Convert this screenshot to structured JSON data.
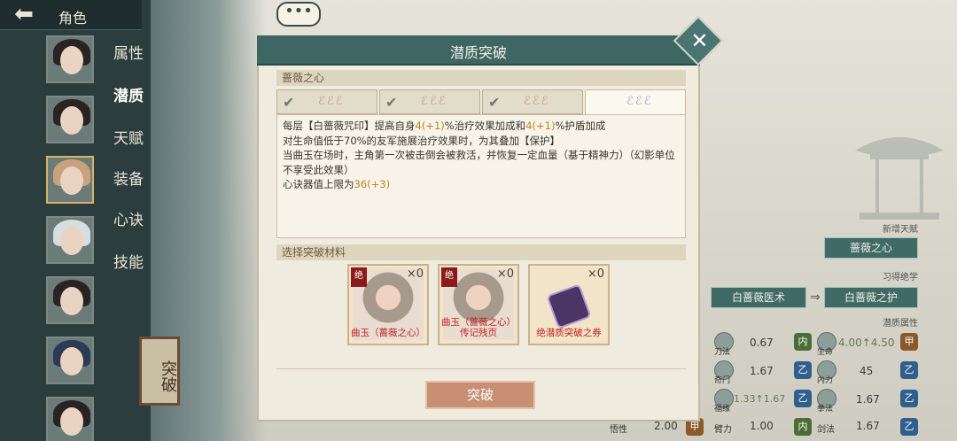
{
  "top_bar": {
    "title": "角色",
    "back_icon": "back-arrow-icon"
  },
  "sidebar": {
    "menu": [
      "属性",
      "潜质",
      "天赋",
      "装备",
      "心诀",
      "技能"
    ],
    "current": "潜质",
    "break_sign": "突破"
  },
  "bubble": {
    "text": "•••"
  },
  "modal": {
    "title": "潜质突破",
    "section_talent": "蔷薇之心",
    "tabs": [
      {
        "check": "✔",
        "sig": "ℰℰℰ",
        "active": false
      },
      {
        "check": "✔",
        "sig": "ℰℰℰ",
        "active": false
      },
      {
        "check": "✔",
        "sig": "ℰℰℰ",
        "active": false
      },
      {
        "check": "",
        "sig": "ℰℰℰ",
        "active": true
      }
    ],
    "desc": {
      "l1a": "每层【白蔷薇咒印】提高自身",
      "l1n1": "4(+1)",
      "l1b": "%治疗效果加成和",
      "l1n2": "4(+1)",
      "l1c": "%护盾加成",
      "l2": "对生命值低于70%的友军施展治疗效果时，为其叠加【保护】",
      "l3": "当曲玉在场时，主角第一次被击倒会被救活，并恢复一定血量（基于精神力）（幻影单位不享受此效果）",
      "l4a": "心诀器值上限为",
      "l4n": "36(+3)"
    },
    "section_material": "选择突破材料",
    "materials": [
      {
        "badge": "绝",
        "count": "×0",
        "name": "曲玉（蔷薇之心）"
      },
      {
        "badge": "绝",
        "count": "×0",
        "name": "曲玉（蔷薇之心）传记残页"
      },
      {
        "badge": "",
        "count": "×0",
        "name": "绝潜质突破之券"
      }
    ],
    "break_button": "突破"
  },
  "right_panel": {
    "new_talent_label": "新增天赋",
    "new_talent": "蔷薇之心",
    "learn_label": "习得绝学",
    "skill_from": "白蔷薇医术",
    "skill_to": "白蔷薇之护",
    "potential_label": "潜质属性",
    "stats": [
      {
        "left_name": "刀法",
        "left_val": "0.67",
        "left_grade": "内",
        "right_name": "生命",
        "right_val": "4.00↑4.50",
        "right_grade": "甲"
      },
      {
        "left_name": "奇门",
        "left_val": "1.67",
        "left_grade": "乙",
        "right_name": "内力",
        "right_val": "45",
        "right_grade": "乙"
      },
      {
        "left_name": "福缘",
        "left_val": "1.33↑1.67",
        "left_grade": "乙",
        "right_name": "拳法",
        "right_val": "1.67",
        "right_grade": "乙"
      },
      {
        "left_name": "悟性",
        "left_val": "2.00",
        "left_grade": "甲",
        "right_name": "臂力",
        "right_val": "1.00",
        "right_grade": "内",
        "extra_name": "剑法",
        "extra_val": "1.67",
        "extra_grade": "乙"
      }
    ]
  }
}
